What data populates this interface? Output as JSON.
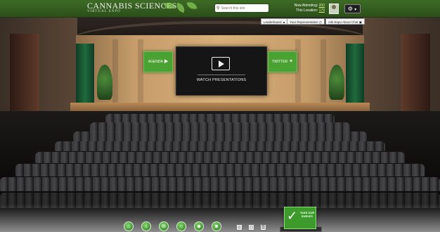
{
  "header": {
    "brand_title": "CANNABIS SCIENCES",
    "brand_subtitle": "VIRTUAL EXPO",
    "search_placeholder": "Search this site",
    "now_attending_label": "Now Attending:",
    "now_attending_value": "200",
    "location_label": "This Location:",
    "location_value": "179"
  },
  "subnav": {
    "leaderboard_label": "Leaderboard",
    "representative_label": "Your Representative",
    "ask_label": "Ask Expo About Chat"
  },
  "stage": {
    "agenda_label": "AGENDA",
    "twitter_label": "TWITTER",
    "screen_label": "WATCH PRESENTATIONS"
  },
  "survey": {
    "label": "TAKE OUR SURVEY"
  },
  "colors": {
    "brand_green": "#3d6b25",
    "button_green": "#4aa233",
    "accent_lime": "#d4f08a"
  },
  "bottom_nav": {
    "icons": [
      "home-icon",
      "info-icon",
      "chat-icon",
      "globe-icon",
      "people-icon",
      "cart-icon"
    ],
    "small_icons": [
      "user-icon",
      "bookmark-icon",
      "document-icon"
    ]
  }
}
